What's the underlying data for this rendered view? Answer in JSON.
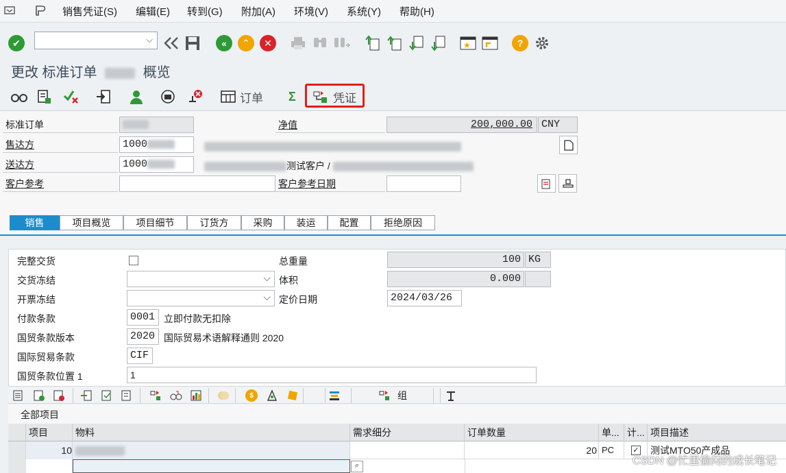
{
  "menu": {
    "items": [
      "销售凭证(S)",
      "编辑(E)",
      "转到(G)",
      "附加(A)",
      "环境(V)",
      "系统(Y)",
      "帮助(H)"
    ]
  },
  "toolbar": {
    "command_value": "",
    "icons": [
      "enter-icon",
      "back-double-icon",
      "save-icon",
      "back-icon",
      "exit-icon",
      "cancel-icon",
      "print-icon",
      "find-icon",
      "find-next-icon",
      "first-page-icon",
      "prev-page-icon",
      "next-page-icon",
      "last-page-icon",
      "new-session-icon",
      "shortcut-icon",
      "help-icon",
      "settings-icon"
    ]
  },
  "title": {
    "prefix": "更改 标准订单",
    "suffix": "概览"
  },
  "app_toolbar": {
    "order_label": "订单",
    "sum_symbol": "Σ",
    "document_label": "凭证"
  },
  "header": {
    "std_order_label": "标准订单",
    "std_order_value": "",
    "net_value_label": "净值",
    "net_value": "200,000.00",
    "currency": "CNY",
    "sold_to_label": "售达方",
    "sold_to_value": "1000",
    "ship_to_label": "送达方",
    "ship_to_value": "1000",
    "ship_to_desc_visible": "测试客户 /",
    "cust_ref_label": "客户参考",
    "cust_ref_value": "",
    "cust_ref_date_label": "客户参考日期",
    "cust_ref_date_value": ""
  },
  "tabs": [
    {
      "label": "销售",
      "active": true
    },
    {
      "label": "项目概览",
      "active": false
    },
    {
      "label": "项目细节",
      "active": false
    },
    {
      "label": "订货方",
      "active": false
    },
    {
      "label": "采购",
      "active": false
    },
    {
      "label": "装运",
      "active": false
    },
    {
      "label": "配置",
      "active": false
    },
    {
      "label": "拒绝原因",
      "active": false
    }
  ],
  "sales": {
    "complete_delivery_label": "完整交货",
    "complete_delivery_checked": false,
    "delivery_block_label": "交货冻结",
    "billing_block_label": "开票冻结",
    "payment_terms_label": "付款条款",
    "payment_terms_code": "0001",
    "payment_terms_desc": "立即付款无扣除",
    "incoterms_version_label": "国贸条款版本",
    "incoterms_version_code": "2020",
    "incoterms_version_desc": "国际贸易术语解释通则 2020",
    "incoterms_label": "国际贸易条款",
    "incoterms_code": "CIF",
    "incoterms_location_label": "国贸条款位置 1",
    "incoterms_location_value": "1",
    "gross_weight_label": "总重量",
    "gross_weight_value": "100",
    "gross_weight_unit": "KG",
    "volume_label": "体积",
    "volume_value": "0.000",
    "volume_unit": "",
    "pricing_date_label": "定价日期",
    "pricing_date_value": "2024/03/26"
  },
  "grid": {
    "group_label": "组",
    "title": "全部项目",
    "columns": [
      "项目",
      "物料",
      "需求细分",
      "订单数量",
      "单...",
      "计...",
      "项目描述"
    ],
    "rows": [
      {
        "item": "10",
        "material": "",
        "req_seg": "",
        "qty": "20",
        "unit": "PC",
        "checked": true,
        "desc": "测试MTO50产成品"
      }
    ]
  },
  "watermark": "CSDN @忙里偷闲的成长笔记"
}
